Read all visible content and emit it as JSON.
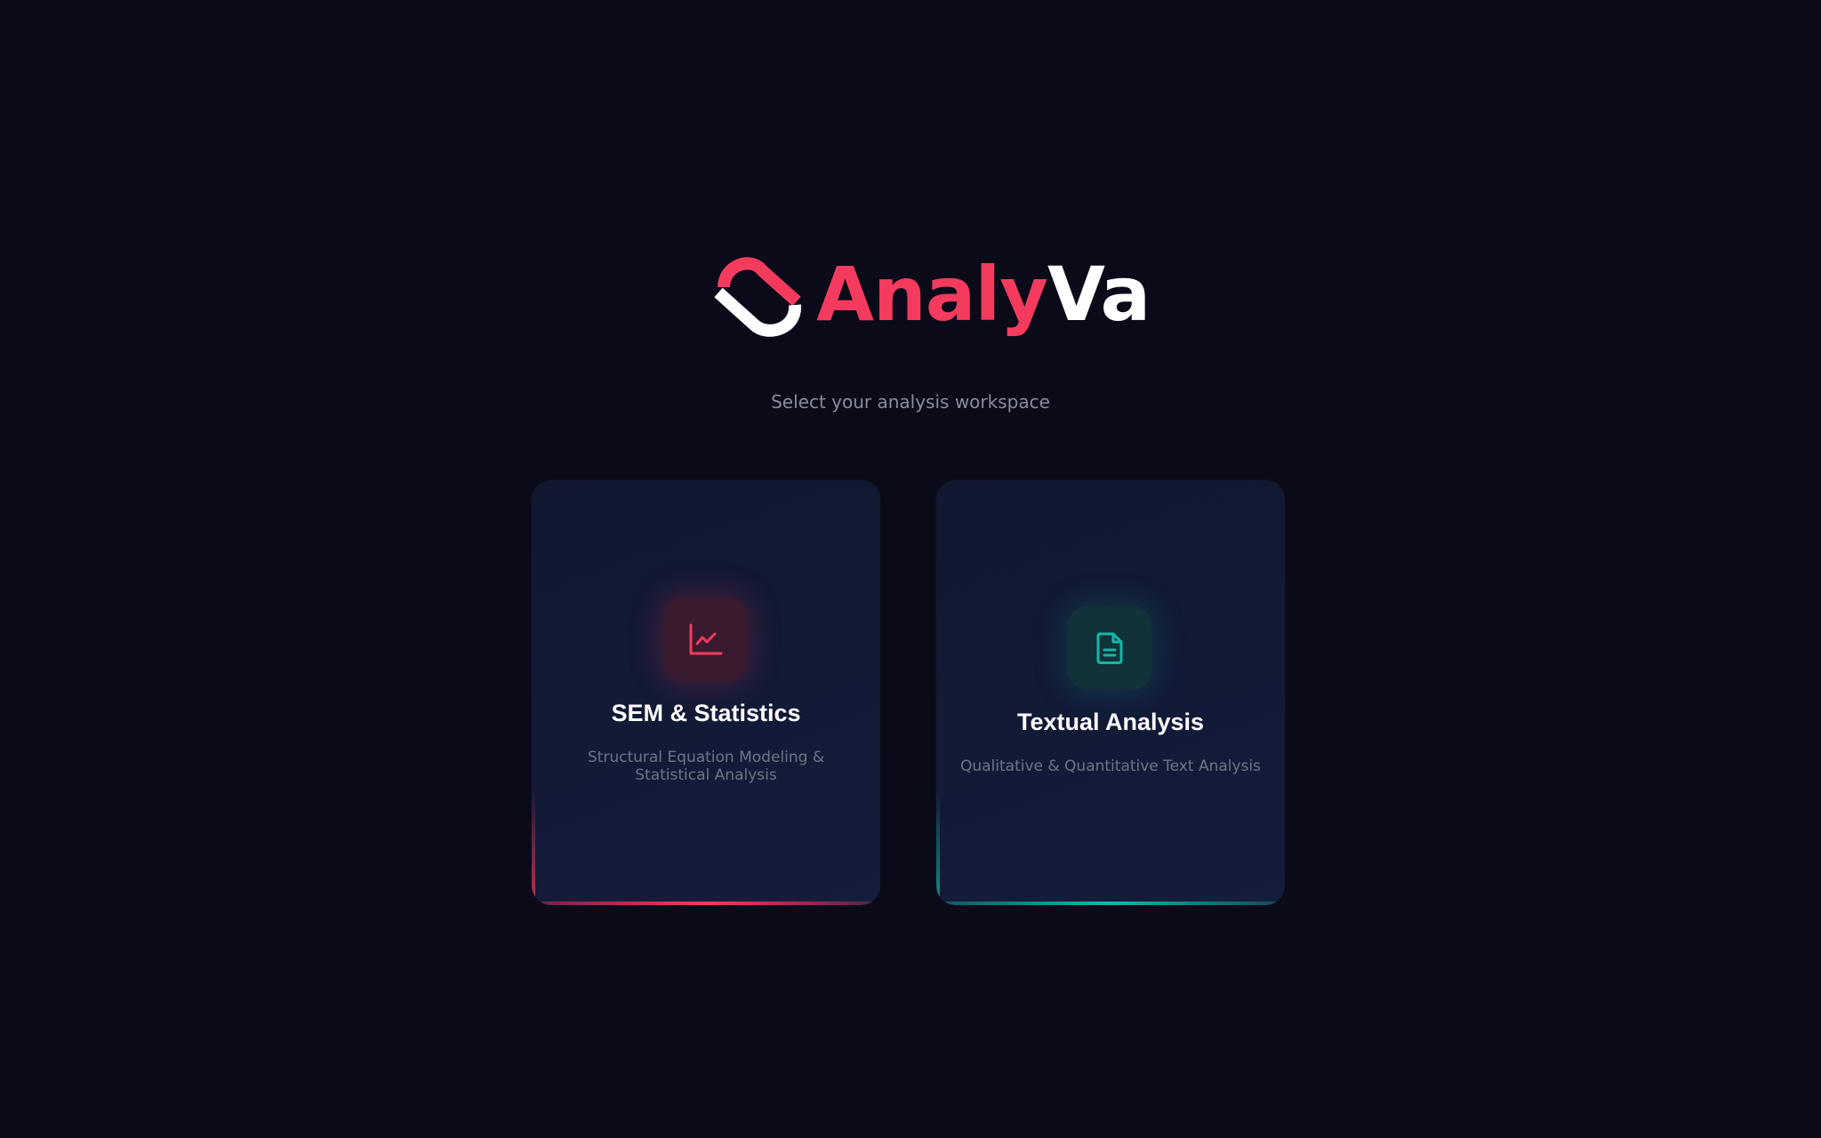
{
  "brand": {
    "name_part1": "Analy",
    "name_part2": "Va",
    "colors": {
      "primary": "#f43b5e",
      "secondary": "#ffffff",
      "background": "#0a0a19"
    }
  },
  "subtitle": "Select your analysis workspace",
  "workspaces": [
    {
      "title": "SEM & Statistics",
      "description": "Structural Equation Modeling & Statistical Analysis",
      "icon": "line-chart-icon",
      "accent_color": "#f43b5e"
    },
    {
      "title": "Textual Analysis",
      "description": "Qualitative & Quantitative Text Analysis",
      "icon": "document-icon",
      "accent_color": "#14b8a6"
    }
  ]
}
